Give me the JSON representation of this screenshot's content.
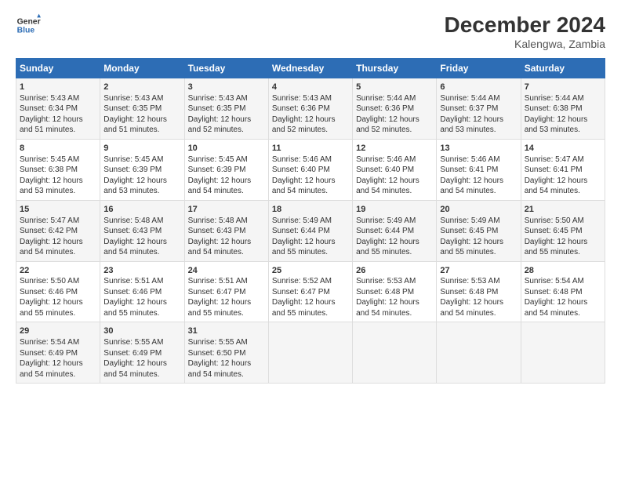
{
  "header": {
    "logo_line1": "General",
    "logo_line2": "Blue",
    "title": "December 2024",
    "subtitle": "Kalengwa, Zambia"
  },
  "days_of_week": [
    "Sunday",
    "Monday",
    "Tuesday",
    "Wednesday",
    "Thursday",
    "Friday",
    "Saturday"
  ],
  "weeks": [
    [
      {
        "day": 1,
        "lines": [
          "Sunrise: 5:43 AM",
          "Sunset: 6:34 PM",
          "Daylight: 12 hours",
          "and 51 minutes."
        ]
      },
      {
        "day": 2,
        "lines": [
          "Sunrise: 5:43 AM",
          "Sunset: 6:35 PM",
          "Daylight: 12 hours",
          "and 51 minutes."
        ]
      },
      {
        "day": 3,
        "lines": [
          "Sunrise: 5:43 AM",
          "Sunset: 6:35 PM",
          "Daylight: 12 hours",
          "and 52 minutes."
        ]
      },
      {
        "day": 4,
        "lines": [
          "Sunrise: 5:43 AM",
          "Sunset: 6:36 PM",
          "Daylight: 12 hours",
          "and 52 minutes."
        ]
      },
      {
        "day": 5,
        "lines": [
          "Sunrise: 5:44 AM",
          "Sunset: 6:36 PM",
          "Daylight: 12 hours",
          "and 52 minutes."
        ]
      },
      {
        "day": 6,
        "lines": [
          "Sunrise: 5:44 AM",
          "Sunset: 6:37 PM",
          "Daylight: 12 hours",
          "and 53 minutes."
        ]
      },
      {
        "day": 7,
        "lines": [
          "Sunrise: 5:44 AM",
          "Sunset: 6:38 PM",
          "Daylight: 12 hours",
          "and 53 minutes."
        ]
      }
    ],
    [
      {
        "day": 8,
        "lines": [
          "Sunrise: 5:45 AM",
          "Sunset: 6:38 PM",
          "Daylight: 12 hours",
          "and 53 minutes."
        ]
      },
      {
        "day": 9,
        "lines": [
          "Sunrise: 5:45 AM",
          "Sunset: 6:39 PM",
          "Daylight: 12 hours",
          "and 53 minutes."
        ]
      },
      {
        "day": 10,
        "lines": [
          "Sunrise: 5:45 AM",
          "Sunset: 6:39 PM",
          "Daylight: 12 hours",
          "and 54 minutes."
        ]
      },
      {
        "day": 11,
        "lines": [
          "Sunrise: 5:46 AM",
          "Sunset: 6:40 PM",
          "Daylight: 12 hours",
          "and 54 minutes."
        ]
      },
      {
        "day": 12,
        "lines": [
          "Sunrise: 5:46 AM",
          "Sunset: 6:40 PM",
          "Daylight: 12 hours",
          "and 54 minutes."
        ]
      },
      {
        "day": 13,
        "lines": [
          "Sunrise: 5:46 AM",
          "Sunset: 6:41 PM",
          "Daylight: 12 hours",
          "and 54 minutes."
        ]
      },
      {
        "day": 14,
        "lines": [
          "Sunrise: 5:47 AM",
          "Sunset: 6:41 PM",
          "Daylight: 12 hours",
          "and 54 minutes."
        ]
      }
    ],
    [
      {
        "day": 15,
        "lines": [
          "Sunrise: 5:47 AM",
          "Sunset: 6:42 PM",
          "Daylight: 12 hours",
          "and 54 minutes."
        ]
      },
      {
        "day": 16,
        "lines": [
          "Sunrise: 5:48 AM",
          "Sunset: 6:43 PM",
          "Daylight: 12 hours",
          "and 54 minutes."
        ]
      },
      {
        "day": 17,
        "lines": [
          "Sunrise: 5:48 AM",
          "Sunset: 6:43 PM",
          "Daylight: 12 hours",
          "and 54 minutes."
        ]
      },
      {
        "day": 18,
        "lines": [
          "Sunrise: 5:49 AM",
          "Sunset: 6:44 PM",
          "Daylight: 12 hours",
          "and 55 minutes."
        ]
      },
      {
        "day": 19,
        "lines": [
          "Sunrise: 5:49 AM",
          "Sunset: 6:44 PM",
          "Daylight: 12 hours",
          "and 55 minutes."
        ]
      },
      {
        "day": 20,
        "lines": [
          "Sunrise: 5:49 AM",
          "Sunset: 6:45 PM",
          "Daylight: 12 hours",
          "and 55 minutes."
        ]
      },
      {
        "day": 21,
        "lines": [
          "Sunrise: 5:50 AM",
          "Sunset: 6:45 PM",
          "Daylight: 12 hours",
          "and 55 minutes."
        ]
      }
    ],
    [
      {
        "day": 22,
        "lines": [
          "Sunrise: 5:50 AM",
          "Sunset: 6:46 PM",
          "Daylight: 12 hours",
          "and 55 minutes."
        ]
      },
      {
        "day": 23,
        "lines": [
          "Sunrise: 5:51 AM",
          "Sunset: 6:46 PM",
          "Daylight: 12 hours",
          "and 55 minutes."
        ]
      },
      {
        "day": 24,
        "lines": [
          "Sunrise: 5:51 AM",
          "Sunset: 6:47 PM",
          "Daylight: 12 hours",
          "and 55 minutes."
        ]
      },
      {
        "day": 25,
        "lines": [
          "Sunrise: 5:52 AM",
          "Sunset: 6:47 PM",
          "Daylight: 12 hours",
          "and 55 minutes."
        ]
      },
      {
        "day": 26,
        "lines": [
          "Sunrise: 5:53 AM",
          "Sunset: 6:48 PM",
          "Daylight: 12 hours",
          "and 54 minutes."
        ]
      },
      {
        "day": 27,
        "lines": [
          "Sunrise: 5:53 AM",
          "Sunset: 6:48 PM",
          "Daylight: 12 hours",
          "and 54 minutes."
        ]
      },
      {
        "day": 28,
        "lines": [
          "Sunrise: 5:54 AM",
          "Sunset: 6:48 PM",
          "Daylight: 12 hours",
          "and 54 minutes."
        ]
      }
    ],
    [
      {
        "day": 29,
        "lines": [
          "Sunrise: 5:54 AM",
          "Sunset: 6:49 PM",
          "Daylight: 12 hours",
          "and 54 minutes."
        ]
      },
      {
        "day": 30,
        "lines": [
          "Sunrise: 5:55 AM",
          "Sunset: 6:49 PM",
          "Daylight: 12 hours",
          "and 54 minutes."
        ]
      },
      {
        "day": 31,
        "lines": [
          "Sunrise: 5:55 AM",
          "Sunset: 6:50 PM",
          "Daylight: 12 hours",
          "and 54 minutes."
        ]
      },
      null,
      null,
      null,
      null
    ]
  ]
}
